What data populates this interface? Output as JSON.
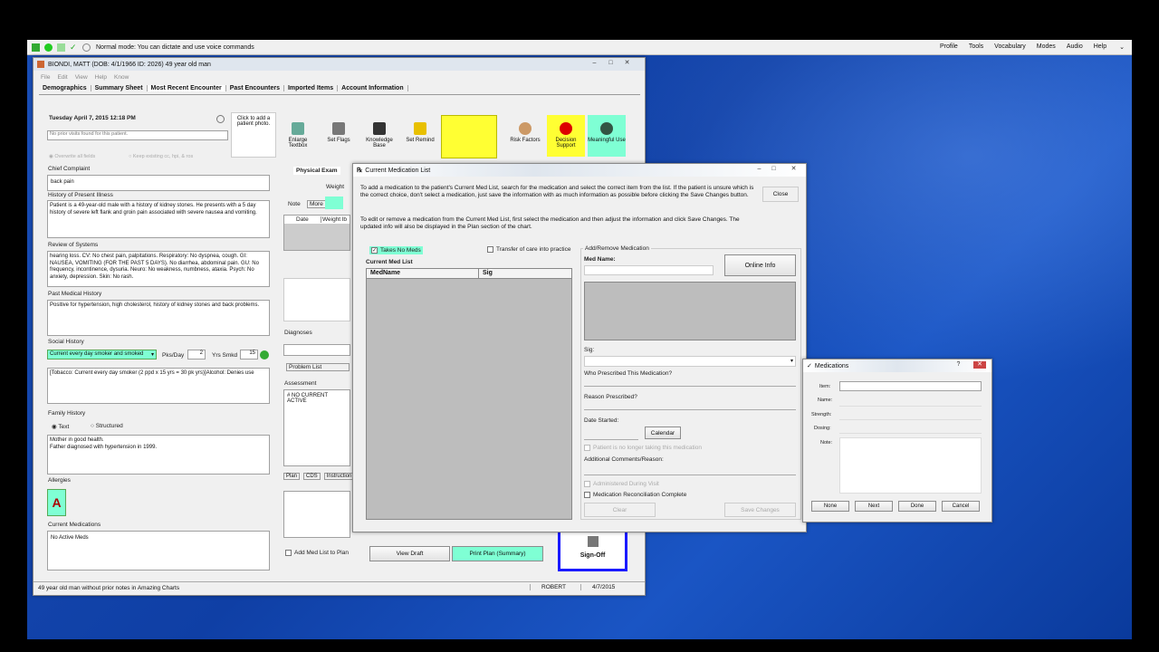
{
  "dragon": {
    "mode": "Normal mode: You can dictate and use voice commands",
    "menu": [
      "Profile",
      "Tools",
      "Vocabulary",
      "Modes",
      "Audio",
      "Help"
    ]
  },
  "patient": {
    "title": "BIONDI, MATT  (DOB: 4/1/1966  ID: 2026)  49 year old man",
    "menu": [
      "File",
      "Edit",
      "View",
      "Help",
      "Know"
    ],
    "tabs": [
      "Demographics",
      "Summary Sheet",
      "Most Recent Encounter",
      "Past Encounters",
      "Imported Items",
      "Account Information"
    ],
    "date": "Tuesday April 7, 2015  12:18 PM",
    "prior_visits": "No prior visits found for this patient.",
    "photo": "Click to add a patient photo.",
    "overwrite": "Overwrite all fields",
    "keep": "Keep existing cc, hpi, & ros",
    "cc_label": "Chief Complaint",
    "cc": "back pain",
    "hpi_label": "History of Present Illness",
    "hpi": "Patient is a 49-year-old male with a history of kidney stones.  He presents with a 5 day history of severe left flank and groin pain associated with severe nausea and vomiting.",
    "ros_label": "Review of Systems",
    "ros": "hearing loss. CV: No chest pain, palpitations. Respiratory: No dyspnea, cough. GI: NAUSEA, VOMITING (FOR THE PAST 5 DAYS). No diarrhea, abdominal pain. GU: No frequency, incontinence, dysuria. Neuro: No weakness, numbness, ataxia. Psych: No anxiety, depression. Skin: No rash.",
    "pmh_label": "Past Medical History",
    "pmh": "Positive for hypertension, high cholesterol, history of kidney stones and back problems.",
    "sh_label": "Social History",
    "smoker": "Current every day smoker and smoked",
    "pks_label": "Pks/Day",
    "pks": "2",
    "yrs_label": "Yrs Smkd",
    "yrs": "15",
    "sh": "[Tobacco: Current every day smoker (2 ppd x 15 yrs = 30 pk yrs)]Alcohol: Denies use",
    "fh_label": "Family History",
    "fh_text": "Text",
    "fh_struct": "Structured",
    "fh": "Mother in good health.\nFather diagnosed with hypertension in 1999.",
    "allergies_label": "Allergies",
    "meds_label": "Current Medications",
    "meds": "No Active Meds",
    "tools": [
      "Enlarge Textbox",
      "Set Flags",
      "Knowledge Base",
      "Set Remind",
      "",
      "Risk Factors",
      "Decision Support",
      "Meaningful Use"
    ],
    "pe_tab": "Physical Exam",
    "weight": "Weight",
    "note": "Note",
    "more": "More",
    "date_col": "Date",
    "weight_col": "Weight lb",
    "diagnoses": "Diagnoses",
    "problem_list": "Problem List",
    "assessment": "Assessment",
    "no_active": "# NO CURRENT ACTIVE",
    "plan_tabs": [
      "Plan",
      "CDS",
      "Instruction"
    ],
    "add_med": "Add Med List to Plan",
    "view_draft": "View Draft",
    "print_plan": "Print Plan (Summary)",
    "signoff": "Sign-Off",
    "status": "49 year old man without prior notes in Amazing Charts",
    "user": "ROBERT",
    "status_date": "4/7/2015"
  },
  "medlist": {
    "title": "Current Medication List",
    "instr1": "To add a medication to the patient's Current Med List, search for the medication and select the correct item from the list. If the patient is unsure which is the correct choice, don't select a medication, just save the information with as much information as possible before clicking the Save Changes button.",
    "instr2": "To edit or remove a medication from the Current Med List, first select the medication and then adjust the information and click Save Changes. The updated info will also be displayed in the Plan section of the chart.",
    "close": "Close",
    "takes_no_meds": "Takes No Meds",
    "transfer": "Transfer of care into practice",
    "list_label": "Current Med List",
    "col_name": "MedName",
    "col_sig": "Sig",
    "group": "Add/Remove Medication",
    "med_name": "Med Name:",
    "online": "Online Info",
    "sig": "Sig:",
    "who": "Who Prescribed This Medication?",
    "reason": "Reason Prescribed?",
    "date_started": "Date Started:",
    "calendar": "Calendar",
    "no_longer": "Patient is no longer taking this medication",
    "comments": "Additional Comments/Reason:",
    "administered": "Administered During Visit",
    "reconcile": "Medication Reconciliation Complete",
    "clear": "Clear",
    "save": "Save Changes"
  },
  "meds_dialog": {
    "title": "Medications",
    "item": "Item:",
    "name": "Name:",
    "strength": "Strength:",
    "dosing": "Dosing:",
    "note": "Note:",
    "buttons": [
      "None",
      "Next",
      "Done",
      "Cancel"
    ]
  },
  "colors": {
    "yellow": "#ffff33",
    "green_hl": "#7fffd4",
    "blue_border": "#1a1aff"
  }
}
